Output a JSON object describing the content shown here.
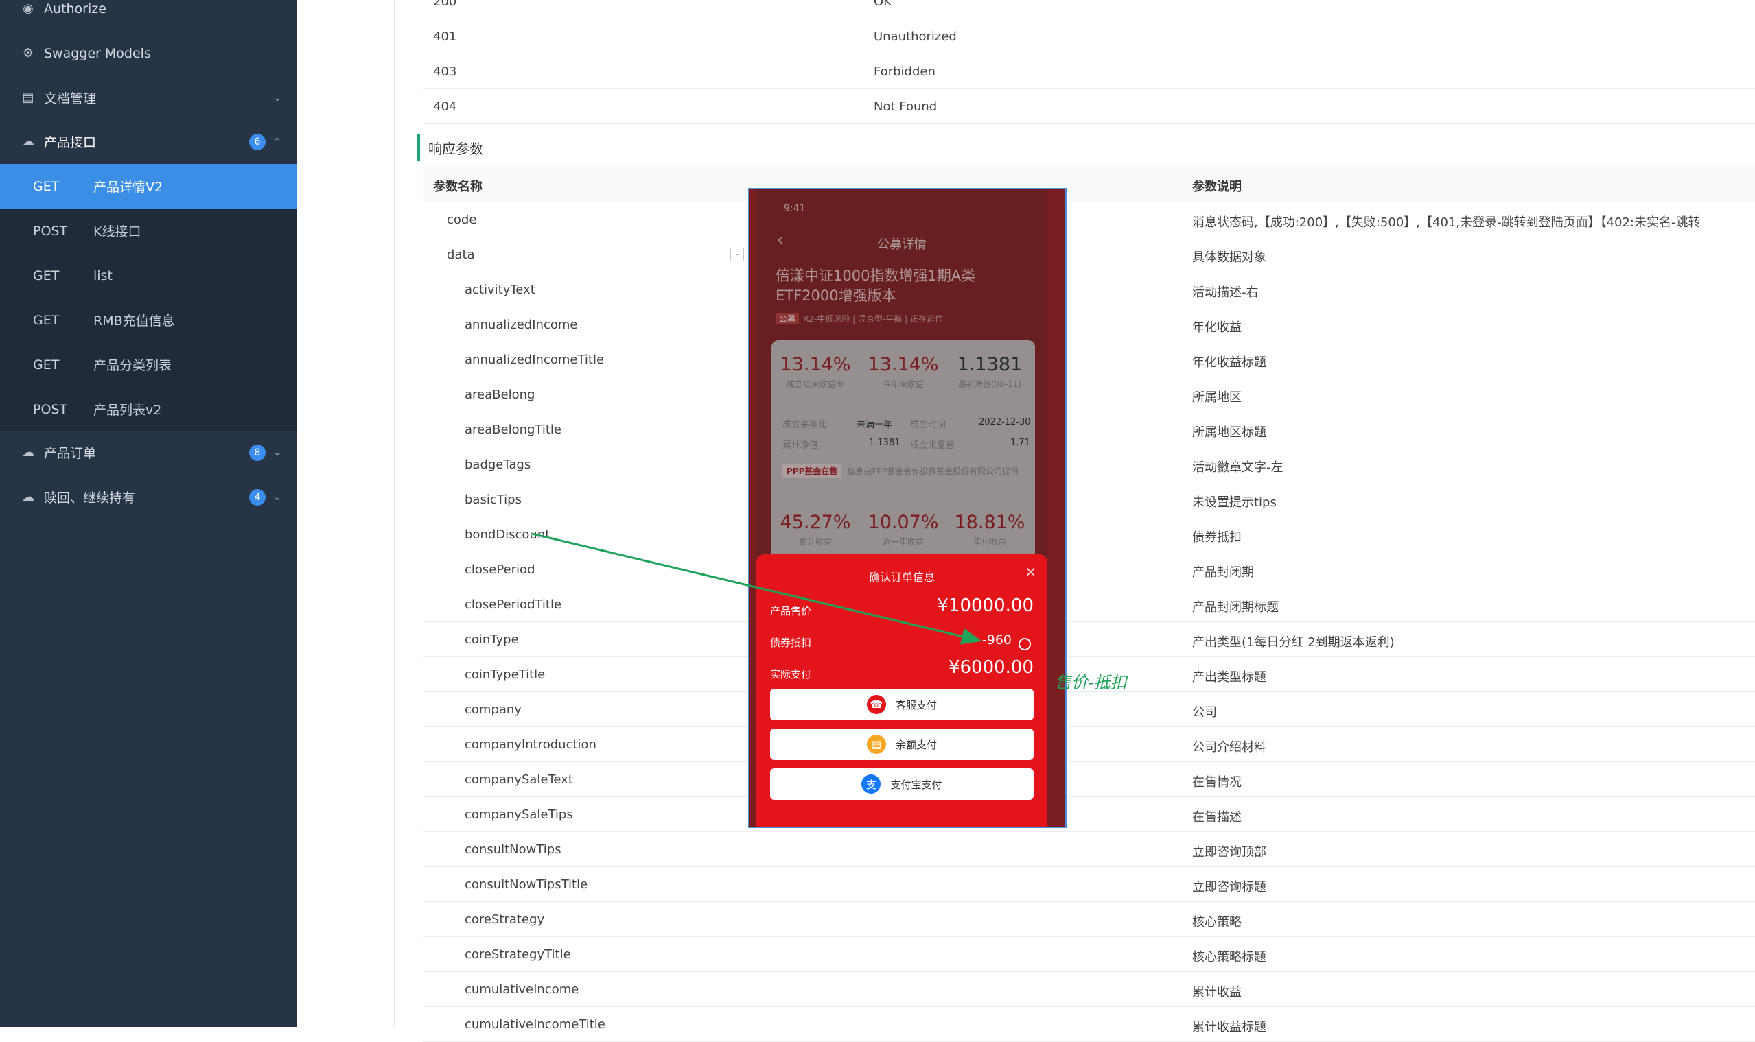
{
  "sidebar": {
    "items": [
      {
        "label": "Authorize",
        "icon": "lock-icon"
      },
      {
        "label": "Swagger Models",
        "icon": "gear-icon"
      },
      {
        "label": "文档管理",
        "icon": "document-icon"
      },
      {
        "label": "产品接口",
        "icon": "cloud-icon",
        "badge": "6"
      },
      {
        "label": "产品订单",
        "icon": "cloud-icon",
        "badge": "8"
      },
      {
        "label": "赎回、继续持有",
        "icon": "cloud-icon",
        "badge": "4"
      }
    ],
    "sub_items": [
      {
        "method": "GET",
        "title": "产品详情V2"
      },
      {
        "method": "POST",
        "title": "K线接口"
      },
      {
        "method": "GET",
        "title": "list"
      },
      {
        "method": "GET",
        "title": "RMB充值信息"
      },
      {
        "method": "GET",
        "title": "产品分类列表"
      },
      {
        "method": "POST",
        "title": "产品列表v2"
      }
    ]
  },
  "status_rows": [
    {
      "code": "200",
      "desc": "OK"
    },
    {
      "code": "401",
      "desc": "Unauthorized"
    },
    {
      "code": "403",
      "desc": "Forbidden"
    },
    {
      "code": "404",
      "desc": "Not Found"
    }
  ],
  "response_section": {
    "title": "响应参数",
    "header_name": "参数名称",
    "header_desc": "参数说明",
    "toggle": "-",
    "params": [
      {
        "name": "code",
        "desc": "消息状态码,【成功:200】,【失败:500】,【401,未登录-跳转到登陆页面】【402:未实名-跳转"
      },
      {
        "name": "data",
        "desc": "具体数据对象"
      },
      {
        "name": "activityText",
        "desc": "活动描述-右"
      },
      {
        "name": "annualizedIncome",
        "desc": "年化收益"
      },
      {
        "name": "annualizedIncomeTitle",
        "desc": "年化收益标题"
      },
      {
        "name": "areaBelong",
        "desc": "所属地区"
      },
      {
        "name": "areaBelongTitle",
        "desc": "所属地区标题"
      },
      {
        "name": "badgeTags",
        "desc": "活动徽章文字-左"
      },
      {
        "name": "basicTips",
        "desc": "未设置提示tips"
      },
      {
        "name": "bondDiscount",
        "desc": "债券抵扣"
      },
      {
        "name": "closePeriod",
        "desc": "产品封闭期"
      },
      {
        "name": "closePeriodTitle",
        "desc": "产品封闭期标题"
      },
      {
        "name": "coinType",
        "desc": "产出类型(1每日分红 2到期返本返利)"
      },
      {
        "name": "coinTypeTitle",
        "desc": "产出类型标题"
      },
      {
        "name": "company",
        "desc": "公司"
      },
      {
        "name": "companyIntroduction",
        "desc": "公司介绍材料"
      },
      {
        "name": "companySaleText",
        "desc": "在售情况"
      },
      {
        "name": "companySaleTips",
        "desc": "在售描述"
      },
      {
        "name": "consultNowTips",
        "desc": "立即咨询顶部"
      },
      {
        "name": "consultNowTipsTitle",
        "desc": "立即咨询标题"
      },
      {
        "name": "coreStrategy",
        "desc": "核心策略"
      },
      {
        "name": "coreStrategyTitle",
        "desc": "核心策略标题"
      },
      {
        "name": "cumulativeIncome",
        "desc": "累计收益"
      },
      {
        "name": "cumulativeIncomeTitle",
        "desc": "累计收益标题"
      }
    ]
  },
  "phone": {
    "time": "9:41",
    "title": "公募详情",
    "fund_name": "倍漾中证1000指数增强1期A类ETF2000增强版本",
    "tag": "公募",
    "tag_line": "R2-中低风险 | 混合型-平衡 | 正在运作",
    "stats_top": [
      {
        "value": "13.14%",
        "label": "成立以来收益率"
      },
      {
        "value": "13.14%",
        "label": "今年来收益"
      },
      {
        "value": "1.1381",
        "label": "最新净值(08-11)"
      }
    ],
    "info": {
      "since_label": "成立来年化",
      "since_value": "未满一年",
      "date_label": "成立时间",
      "date_value": "2022-12-30",
      "nav_label": "累计净值",
      "nav_value": "1.1381",
      "multiple_label": "成立来夏普",
      "multiple_value": "1.71"
    },
    "ppp_badge": "PPP基金在售",
    "ppp_text": "信息由PPP基金合作投资基金股份有限公司提供",
    "stats_bottom": [
      {
        "value": "45.27%",
        "label": "累计收益"
      },
      {
        "value": "10.07%",
        "label": "近一年收益"
      },
      {
        "value": "18.81%",
        "label": "年化收益"
      }
    ],
    "sheet": {
      "title": "确认订单信息",
      "price_label": "产品售价",
      "price_value": "¥10000.00",
      "discount_label": "债券抵扣",
      "discount_value": "-960",
      "pay_label": "实际支付",
      "pay_value": "¥6000.00",
      "buttons": [
        "客服支付",
        "余额支付",
        "支付宝支付"
      ]
    }
  },
  "annotation": "售价-抵扣",
  "colors": {
    "sidebar_bg": "#263445",
    "selected": "#3a8ee6",
    "accent_green": "#20a35a",
    "sheet_red": "#e3141a"
  }
}
